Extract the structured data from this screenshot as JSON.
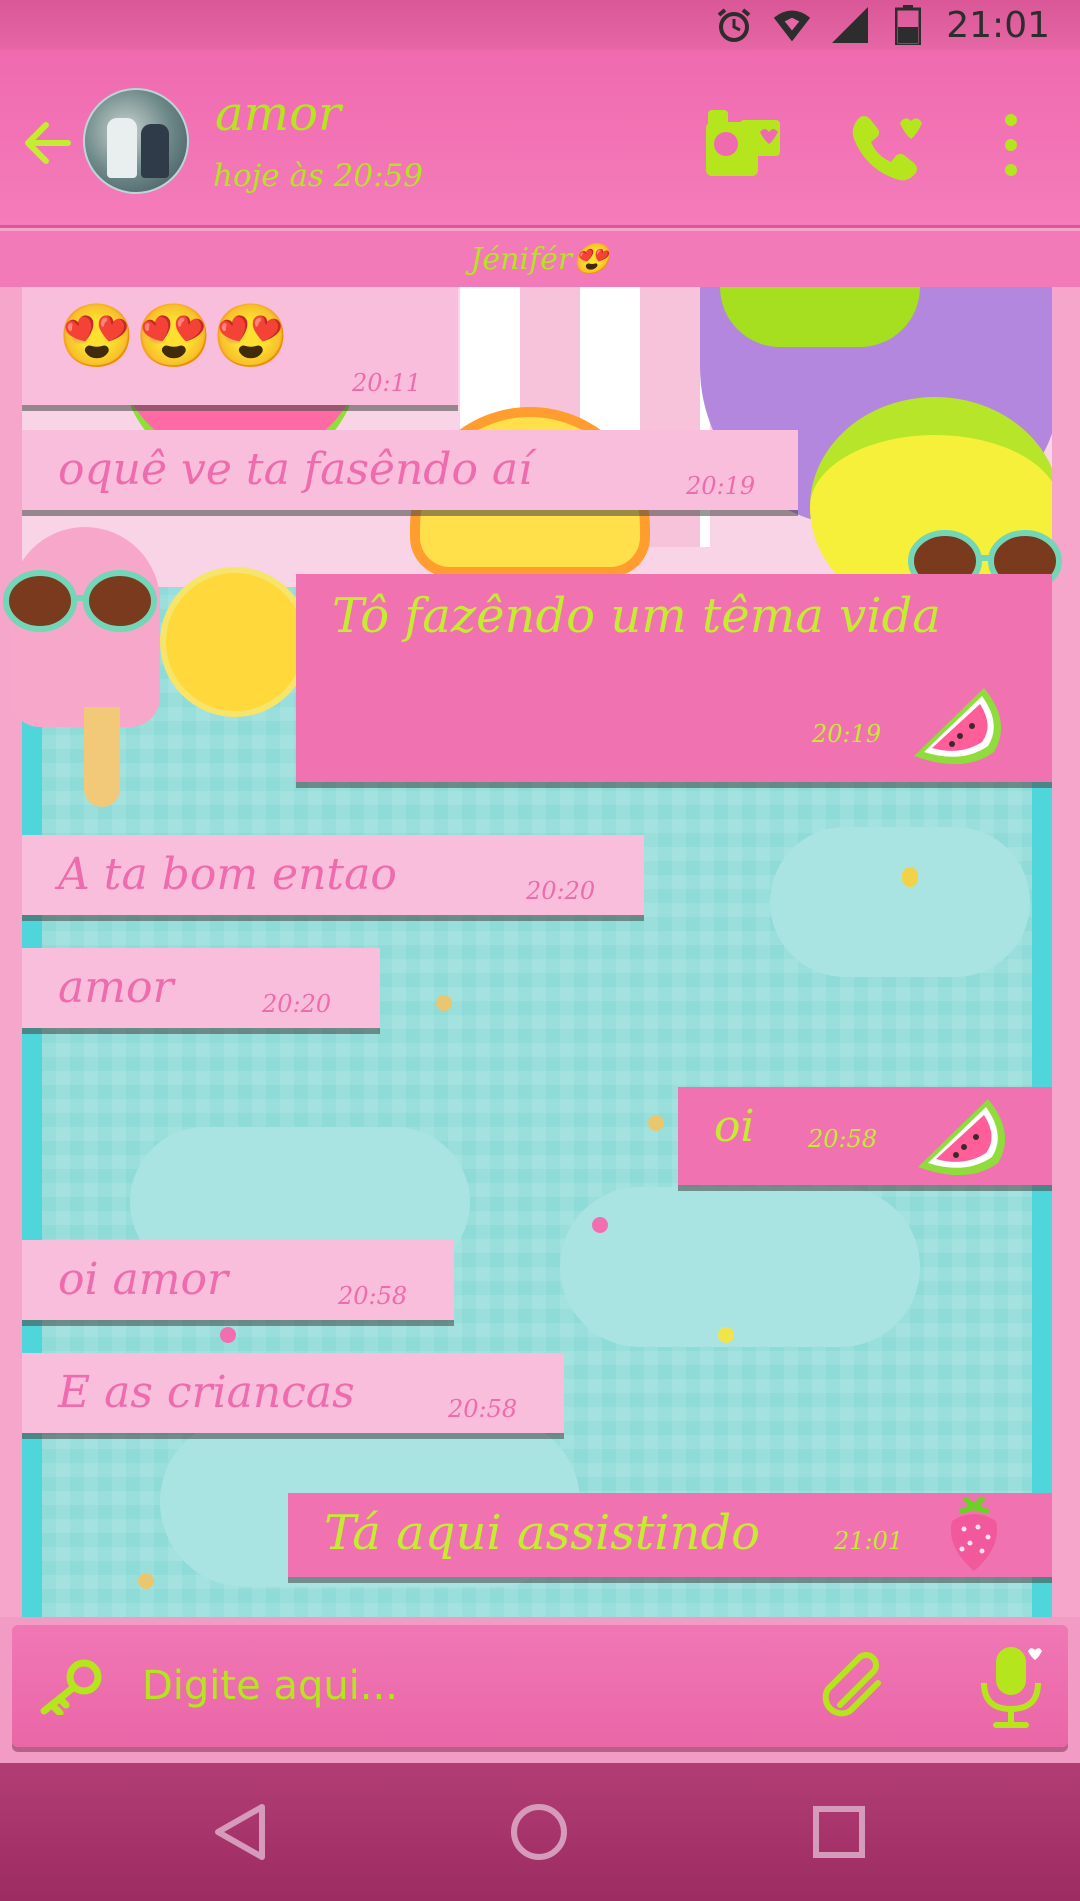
{
  "status_bar": {
    "time": "21:01",
    "icons": [
      "alarm-icon",
      "wifi-icon",
      "signal-icon",
      "battery-icon"
    ]
  },
  "header": {
    "contact_name": "amor",
    "last_seen": "hoje às 20:59",
    "icons": [
      "back-arrow-icon",
      "video-call-icon",
      "phone-heart-icon",
      "more-vert-icon"
    ]
  },
  "contact_strip": {
    "label": "Jénifér😍"
  },
  "messages": [
    {
      "direction": "in",
      "text": "😍😍😍",
      "time": "20:11"
    },
    {
      "direction": "in",
      "text": "oquê ve ta fasêndo aí",
      "time": "20:19"
    },
    {
      "direction": "out",
      "text": "Tô fazêndo um têma vida",
      "time": "20:19",
      "sticker": "watermelon-icon"
    },
    {
      "direction": "in",
      "text": "A ta bom entao",
      "time": "20:20"
    },
    {
      "direction": "in",
      "text": "amor",
      "time": "20:20"
    },
    {
      "direction": "out",
      "text": "oi",
      "time": "20:58",
      "sticker": "watermelon-icon"
    },
    {
      "direction": "in",
      "text": "oi amor",
      "time": "20:58"
    },
    {
      "direction": "in",
      "text": "E as criancas",
      "time": "20:58"
    },
    {
      "direction": "out",
      "text": "Tá aqui assistindo",
      "time": "21:01",
      "sticker": "strawberry-icon"
    }
  ],
  "input": {
    "placeholder": "Digite aqui...",
    "icons": [
      "key-icon",
      "attach-icon",
      "mic-icon"
    ]
  },
  "nav": {
    "icons": [
      "back-triangle-icon",
      "home-circle-icon",
      "recents-square-icon"
    ]
  },
  "colors": {
    "accent": "#b5e61d",
    "header_pink": "#f06ab0",
    "bubble_in": "#f8bedb",
    "bubble_out": "#f172b0",
    "chat_bg": "#8fdbd8"
  }
}
